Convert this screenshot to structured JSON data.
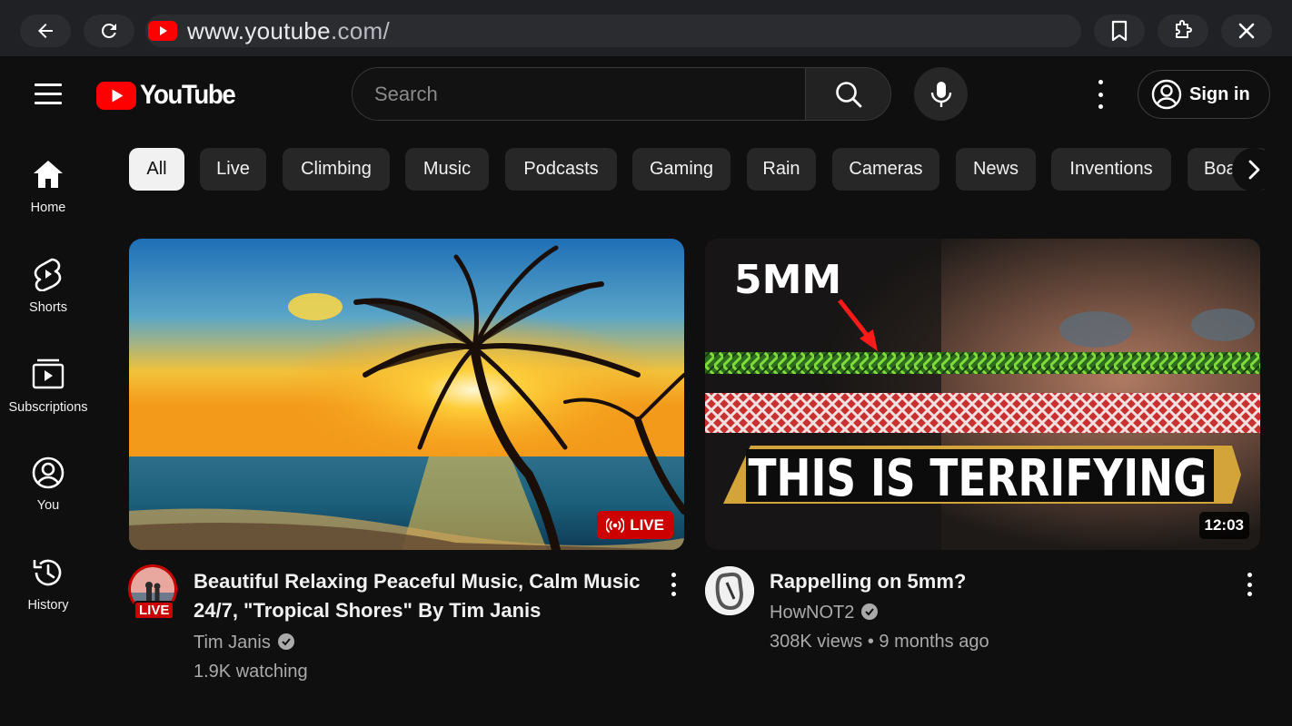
{
  "browser": {
    "url_host": "www.youtube",
    "url_rest": ".com/"
  },
  "header": {
    "logo_text": "YouTube",
    "search_placeholder": "Search",
    "signin_label": "Sign in"
  },
  "sidebar": {
    "items": [
      {
        "label": "Home",
        "icon": "home-icon"
      },
      {
        "label": "Shorts",
        "icon": "shorts-icon"
      },
      {
        "label": "Subscriptions",
        "icon": "subscriptions-icon"
      },
      {
        "label": "You",
        "icon": "you-icon"
      },
      {
        "label": "History",
        "icon": "history-icon"
      }
    ]
  },
  "chips": [
    "All",
    "Live",
    "Climbing",
    "Music",
    "Podcasts",
    "Gaming",
    "Rain",
    "Cameras",
    "News",
    "Inventions",
    "Boa"
  ],
  "videos": [
    {
      "title": "Beautiful Relaxing Peaceful Music, Calm Music 24/7, \"Tropical Shores\" By Tim Janis",
      "title_line1": "Beautiful Relaxing Peaceful Music, Calm Music",
      "title_line2": "24/7, \"Tropical Shores\" By Tim Janis",
      "channel": "Tim Janis",
      "stats": "1.9K watching",
      "badge": "LIVE",
      "avatar_badge": "LIVE"
    },
    {
      "title": "Rappelling on 5mm?",
      "channel": "HowNOT2",
      "stats": "308K views • 9 months ago",
      "duration": "12:03",
      "thumb_top_text": "5MM",
      "thumb_banner_text": "THIS IS TERRIFYING"
    }
  ],
  "colors": {
    "background": "#0f0f0f",
    "brand_red": "#ff0000",
    "chip_bg": "#272727",
    "chip_active_bg": "#f1f1f1",
    "secondary_text": "#aaaaaa"
  }
}
